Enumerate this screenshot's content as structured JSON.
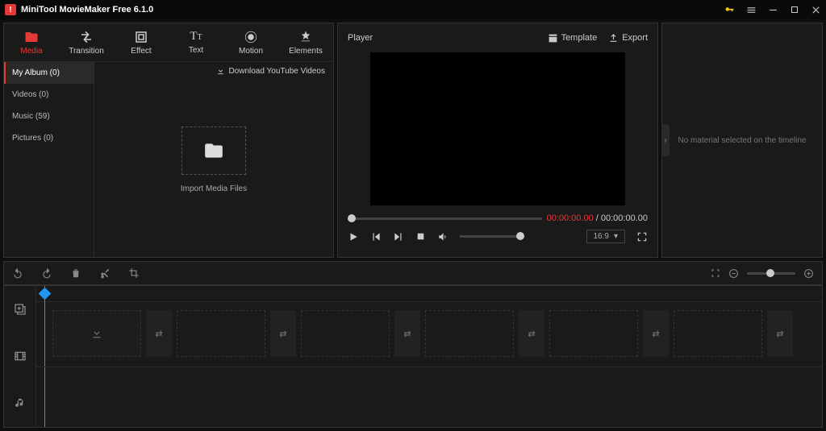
{
  "app": {
    "title": "MiniTool MovieMaker Free 6.1.0"
  },
  "tabs": [
    {
      "label": "Media",
      "icon": "folder"
    },
    {
      "label": "Transition",
      "icon": "trans"
    },
    {
      "label": "Effect",
      "icon": "effect"
    },
    {
      "label": "Text",
      "icon": "text"
    },
    {
      "label": "Motion",
      "icon": "motion"
    },
    {
      "label": "Elements",
      "icon": "elements"
    }
  ],
  "sidebar": {
    "items": [
      {
        "label": "My Album (0)"
      },
      {
        "label": "Videos (0)"
      },
      {
        "label": "Music (59)"
      },
      {
        "label": "Pictures (0)"
      }
    ]
  },
  "media": {
    "download_label": "Download YouTube Videos",
    "import_label": "Import Media Files"
  },
  "player": {
    "title": "Player",
    "template_label": "Template",
    "export_label": "Export",
    "time_current": "00:00:00.00",
    "time_sep": " / ",
    "time_total": "00:00:00.00",
    "ratio": "16:9"
  },
  "inspector": {
    "empty": "No material selected on the timeline"
  }
}
